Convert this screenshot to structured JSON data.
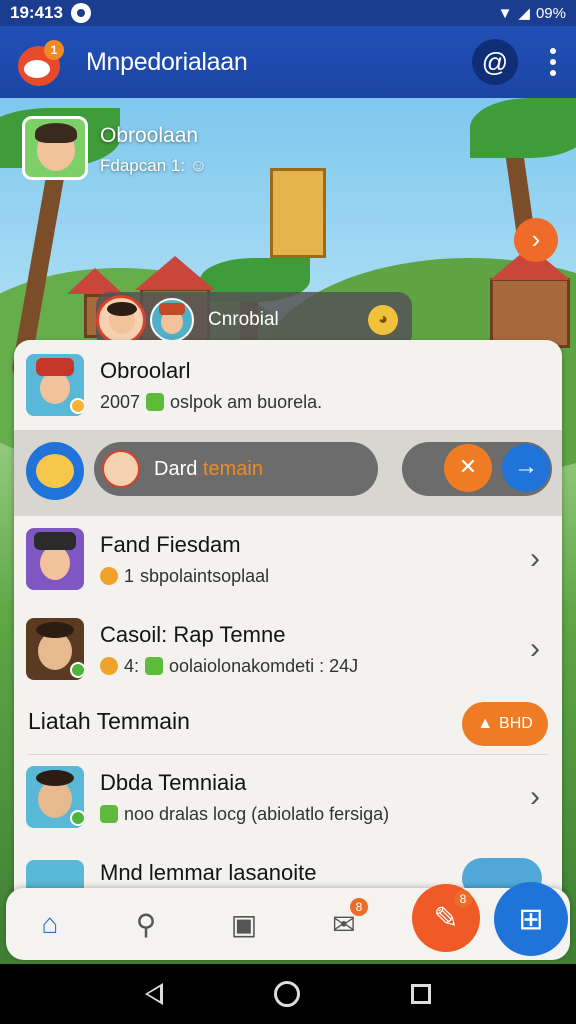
{
  "status_bar": {
    "time": "19:413",
    "battery": "09%"
  },
  "app_bar": {
    "title": "Mnpedorialaan",
    "logo_badge": "1"
  },
  "hero": {
    "name": "Obroolaan",
    "subtitle": "Fdapcan 1:"
  },
  "floating_pill": {
    "label": "Cnrobial"
  },
  "first_chat": {
    "name": "Obroolarl",
    "meta": "2007",
    "message": "oslpok am buorela."
  },
  "action_strip": {
    "pill_text": "Dard ",
    "pill_accent": "temain"
  },
  "chats": [
    {
      "name": "Fand Fiesdam",
      "meta": "1",
      "message": "sbpolaintsoplaal"
    },
    {
      "name": "Casoil: Rap Temne",
      "meta": "4:",
      "message": "oolaiolonakomdeti : 24J"
    }
  ],
  "section": {
    "title": "Liatah Temmain",
    "button": "BHD"
  },
  "third_chat": {
    "name": "Dbda Temniaia",
    "message": "noo dralas locg (abiolatlo fersiga)"
  },
  "peek_card": {
    "title": "Mnd lemmar lasanoite"
  },
  "bottom_nav": {
    "messages_badge": "8",
    "fab_badge": "8"
  },
  "colors": {
    "primary": "#2150b8",
    "accent": "#ef7c24",
    "blue": "#1f73d9"
  }
}
